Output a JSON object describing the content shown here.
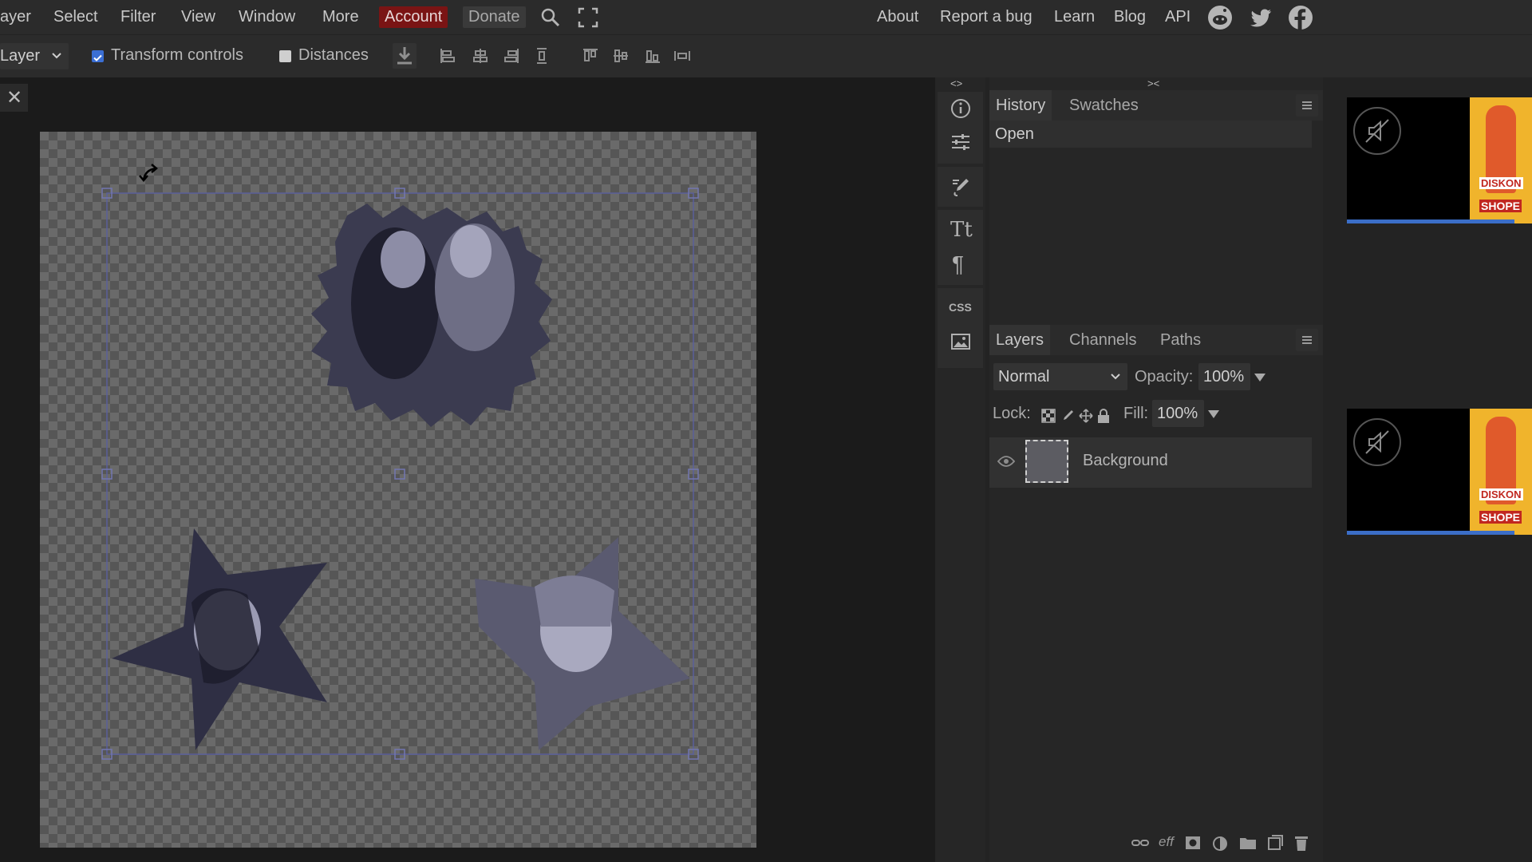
{
  "menubar": {
    "items": [
      "ayer",
      "Select",
      "Filter",
      "View",
      "Window",
      "More",
      "Account",
      "Donate"
    ],
    "right_links": [
      "About",
      "Report a bug",
      "Learn",
      "Blog",
      "API"
    ],
    "social_icons": [
      "reddit-icon",
      "twitter-icon",
      "facebook-icon"
    ],
    "extra_icons": [
      "search-icon",
      "fullscreen-icon"
    ],
    "accent": "#7a1414"
  },
  "toolbar": {
    "select_value": "Layer",
    "transform_label": "Transform controls",
    "transform_checked": true,
    "distances_label": "Distances",
    "distances_checked": false
  },
  "document": {
    "close_glyph": "✕"
  },
  "history_panel": {
    "tabs": [
      "History",
      "Swatches"
    ],
    "items": [
      "Open"
    ],
    "collapse_left": "<>",
    "collapse_right": "><"
  },
  "layers_panel": {
    "tabs": [
      "Layers",
      "Channels",
      "Paths"
    ],
    "blend_mode": "Normal",
    "opacity_label": "Opacity:",
    "opacity_value": "100%",
    "lock_label": "Lock:",
    "fill_label": "Fill:",
    "fill_value": "100%",
    "layers": [
      {
        "name": "Background",
        "visible": true
      }
    ],
    "footer_icons": [
      "link-icon",
      "effects-icon",
      "mask-icon",
      "adjustment-icon",
      "folder-icon",
      "new-layer-icon",
      "trash-icon"
    ],
    "effects_text": "eff"
  },
  "toolstrip": {
    "icons": [
      "info-icon",
      "sliders-icon",
      "brush-settings-icon",
      "character-icon",
      "paragraph-icon",
      "css-icon",
      "image-icon"
    ],
    "char_label": "Tt",
    "para_label": "¶",
    "css_label": "CSS"
  },
  "ads": {
    "banner_text": [
      "DISKON",
      "SHOPE"
    ]
  }
}
